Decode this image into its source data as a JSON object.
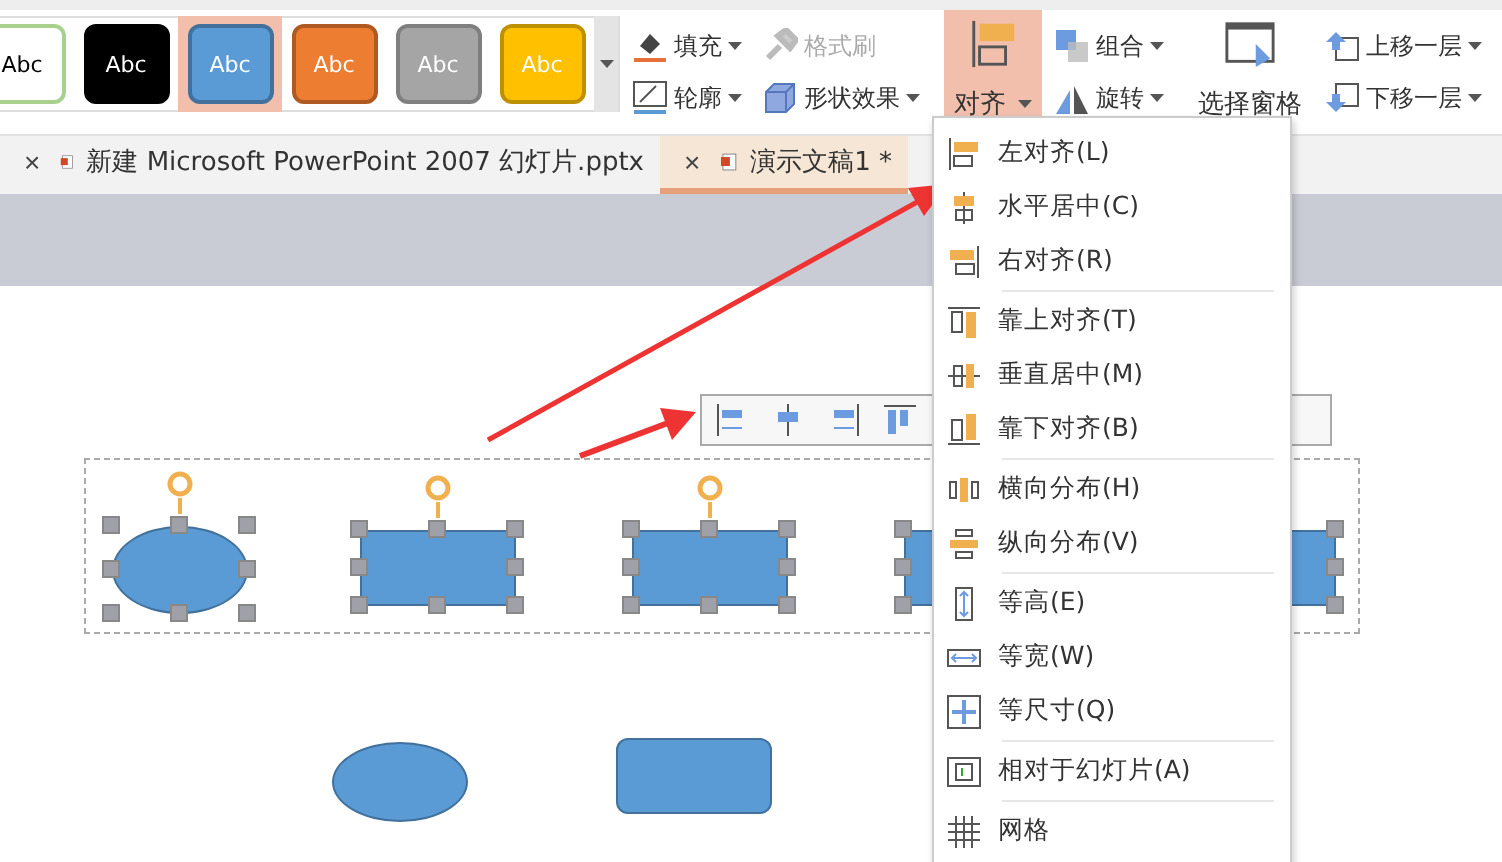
{
  "ribbon": {
    "style_gallery": [
      {
        "label": "Abc",
        "color": "#ffffff",
        "selected": false
      },
      {
        "label": "Abc",
        "color": "#000000",
        "selected": false
      },
      {
        "label": "Abc",
        "color": "#5b9bd5",
        "selected": true
      },
      {
        "label": "Abc",
        "color": "#ed7d31",
        "selected": false
      },
      {
        "label": "Abc",
        "color": "#a5a5a5",
        "selected": false
      },
      {
        "label": "Abc",
        "color": "#ffc000",
        "selected": false
      }
    ],
    "fill": {
      "label": "填充",
      "disabled": false
    },
    "format_painter": {
      "label": "格式刷",
      "disabled": true
    },
    "outline": {
      "label": "轮廓",
      "disabled": false
    },
    "shape_effects": {
      "label": "形状效果",
      "disabled": false
    },
    "align": {
      "label": "对齐",
      "selected": true
    },
    "group": {
      "label": "组合"
    },
    "rotate": {
      "label": "旋转"
    },
    "selection_pane": {
      "label": "选择窗格"
    },
    "bring_forward": {
      "label": "上移一层"
    },
    "send_backward": {
      "label": "下移一层"
    }
  },
  "tabs": [
    {
      "label": "新建 Microsoft PowerPoint 2007 幻灯片.pptx",
      "selected": false,
      "close": "×"
    },
    {
      "label": "演示文稿1 *",
      "selected": true,
      "close": "×"
    }
  ],
  "align_menu": {
    "groups": [
      [
        {
          "label": "左对齐(L)"
        },
        {
          "label": "水平居中(C)"
        },
        {
          "label": "右对齐(R)"
        }
      ],
      [
        {
          "label": "靠上对齐(T)"
        },
        {
          "label": "垂直居中(M)"
        },
        {
          "label": "靠下对齐(B)"
        }
      ],
      [
        {
          "label": "横向分布(H)"
        },
        {
          "label": "纵向分布(V)"
        }
      ],
      [
        {
          "label": "等高(E)"
        },
        {
          "label": "等宽(W)"
        },
        {
          "label": "等尺寸(Q)"
        }
      ],
      [
        {
          "label": "相对于幻灯片(A)"
        }
      ],
      [
        {
          "label": "网格"
        }
      ]
    ]
  },
  "canvas": {
    "shapes": [
      {
        "kind": "ellipse",
        "selected": true
      },
      {
        "kind": "rectangle",
        "selected": true
      },
      {
        "kind": "rectangle",
        "selected": true
      },
      {
        "kind": "rectangle",
        "selected": true
      },
      {
        "kind": "rectangle",
        "selected": true
      },
      {
        "kind": "ellipse",
        "selected": false
      },
      {
        "kind": "rounded-rectangle",
        "selected": false
      }
    ]
  }
}
